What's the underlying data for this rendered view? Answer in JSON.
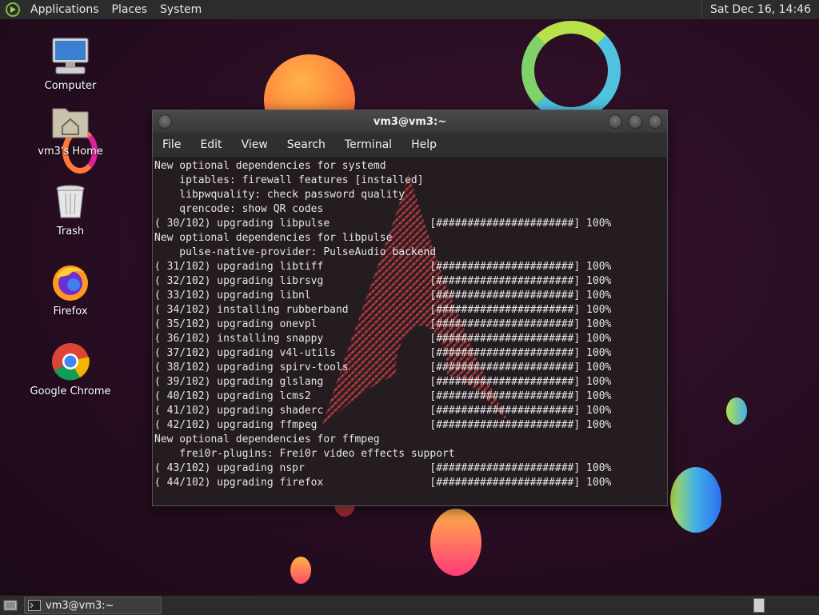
{
  "top_panel": {
    "menus": [
      "Applications",
      "Places",
      "System"
    ],
    "clock": "Sat Dec 16, 14:46"
  },
  "desktop_icons": [
    {
      "label": "Computer",
      "icon": "computer-icon"
    },
    {
      "label": "vm3's Home",
      "icon": "home-folder-icon"
    },
    {
      "label": "Trash",
      "icon": "trash-icon"
    },
    {
      "label": "Firefox",
      "icon": "firefox-icon"
    },
    {
      "label": "Google Chrome",
      "icon": "chrome-icon"
    }
  ],
  "terminal": {
    "title": "vm3@vm3:~",
    "menu": [
      "File",
      "Edit",
      "View",
      "Search",
      "Terminal",
      "Help"
    ],
    "lines": [
      "New optional dependencies for systemd",
      "    iptables: firewall features [installed]",
      "    libpwquality: check password quality",
      "    qrencode: show QR codes",
      "( 30/102) upgrading libpulse                [######################] 100%",
      "New optional dependencies for libpulse",
      "    pulse-native-provider: PulseAudio backend",
      "( 31/102) upgrading libtiff                 [######################] 100%",
      "( 32/102) upgrading librsvg                 [######################] 100%",
      "( 33/102) upgrading libnl                   [######################] 100%",
      "( 34/102) installing rubberband             [######################] 100%",
      "( 35/102) upgrading onevpl                  [######################] 100%",
      "( 36/102) installing snappy                 [######################] 100%",
      "( 37/102) upgrading v4l-utils               [######################] 100%",
      "( 38/102) upgrading spirv-tools             [######################] 100%",
      "( 39/102) upgrading glslang                 [######################] 100%",
      "( 40/102) upgrading lcms2                   [######################] 100%",
      "( 41/102) upgrading shaderc                 [######################] 100%",
      "( 42/102) upgrading ffmpeg                  [######################] 100%",
      "New optional dependencies for ffmpeg",
      "    frei0r-plugins: Frei0r video effects support",
      "( 43/102) upgrading nspr                    [######################] 100%",
      "( 44/102) upgrading firefox                 [######################] 100%"
    ]
  },
  "taskbar": {
    "items": [
      {
        "label": "vm3@vm3:~",
        "icon": "terminal-icon"
      }
    ]
  },
  "colors": {
    "panel_bg": "#2c2c2c",
    "terminal_bg": "#251c22",
    "terminal_text": "#e4e4e4",
    "wallpaper": "#2a0e24"
  }
}
